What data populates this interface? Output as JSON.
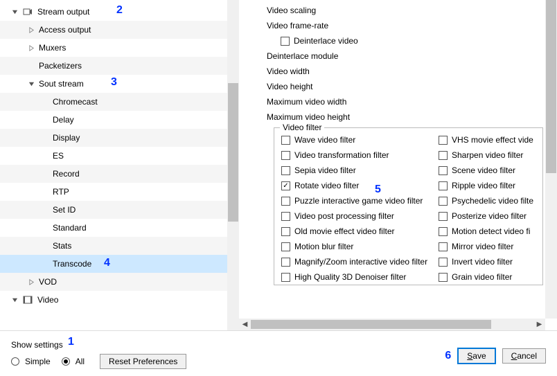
{
  "tree": {
    "stream_output": "Stream output",
    "access_output": "Access output",
    "muxers": "Muxers",
    "packetizers": "Packetizers",
    "sout_stream": "Sout stream",
    "chromecast": "Chromecast",
    "delay": "Delay",
    "display": "Display",
    "es": "ES",
    "record": "Record",
    "rtp": "RTP",
    "set_id": "Set ID",
    "standard": "Standard",
    "stats": "Stats",
    "transcode": "Transcode",
    "vod": "VOD",
    "video": "Video"
  },
  "settings": {
    "video_scaling": "Video scaling",
    "video_frame_rate": "Video frame-rate",
    "deinterlace_video": "Deinterlace video",
    "deinterlace_module": "Deinterlace module",
    "video_width": "Video width",
    "video_height": "Video height",
    "max_video_width": "Maximum video width",
    "max_video_height": "Maximum video height",
    "video_filter_legend": "Video filter"
  },
  "filters_left": [
    "Wave video filter",
    "Video transformation filter",
    "Sepia video filter",
    "Rotate video filter",
    "Puzzle interactive game video filter",
    "Video post processing filter",
    "Old movie effect video filter",
    "Motion blur filter",
    "Magnify/Zoom interactive video filter",
    "High Quality 3D Denoiser filter"
  ],
  "filters_right": [
    "VHS movie effect vide",
    "Sharpen video filter",
    "Scene video filter",
    "Ripple video filter",
    "Psychedelic video filte",
    "Posterize video filter",
    "Motion detect video fi",
    "Mirror video filter",
    "Invert video filter",
    "Grain video filter"
  ],
  "filters_left_checked": [
    false,
    false,
    false,
    true,
    false,
    false,
    false,
    false,
    false,
    false
  ],
  "bottom": {
    "show_settings": "Show settings",
    "simple": "Simple",
    "all": "All",
    "reset": "Reset Preferences",
    "save": "Save",
    "cancel": "Cancel"
  },
  "annotations": {
    "a1": "1",
    "a2": "2",
    "a3": "3",
    "a4": "4",
    "a5": "5",
    "a6": "6"
  }
}
